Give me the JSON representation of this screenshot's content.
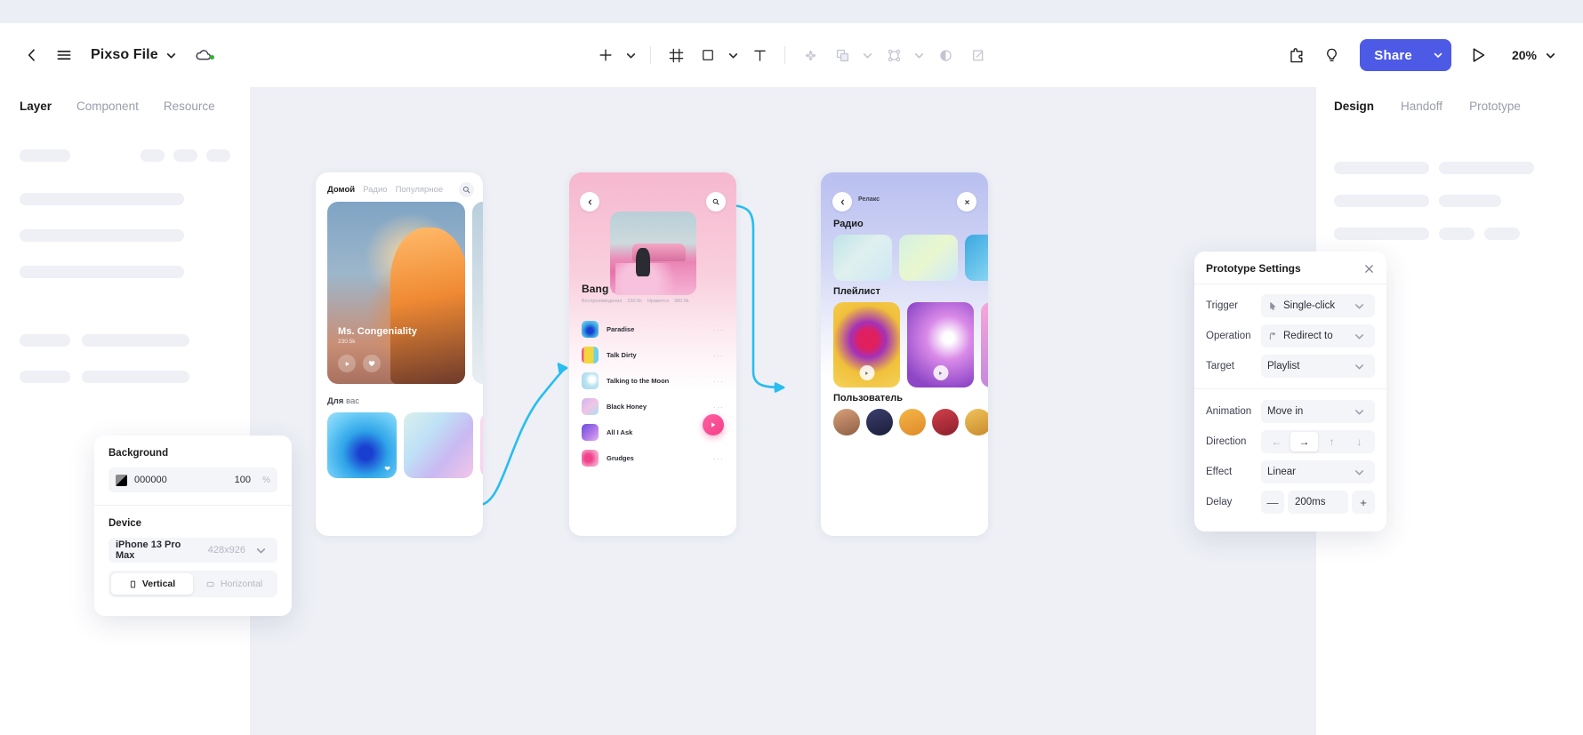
{
  "app": {
    "file_title": "Pixso File",
    "zoom_level": "20%",
    "share_label": "Share"
  },
  "topbar": {
    "back_icon": "chevron-left-icon",
    "menu_icon": "hamburger-menu-icon",
    "title_chevron_icon": "chevron-down-icon",
    "cloud_icon": "cloud-saved-icon",
    "tools": [
      {
        "name": "add-icon",
        "label": "Add",
        "dim": false,
        "chevron": true
      },
      {
        "name": "frame-icon",
        "label": "Frame",
        "dim": false,
        "chevron": false
      },
      {
        "name": "shape-rectangle-icon",
        "label": "Shape",
        "dim": false,
        "chevron": true
      },
      {
        "name": "text-icon",
        "label": "Text",
        "dim": false,
        "chevron": false
      },
      {
        "name": "vector-move-icon",
        "label": "Vector",
        "dim": true,
        "chevron": false
      },
      {
        "name": "boolean-union-icon",
        "label": "Boolean",
        "dim": true,
        "chevron": true
      },
      {
        "name": "component-icon",
        "label": "Component",
        "dim": true,
        "chevron": true
      },
      {
        "name": "mask-icon",
        "label": "Mask",
        "dim": true,
        "chevron": false
      },
      {
        "name": "slice-icon",
        "label": "Slice",
        "dim": true,
        "chevron": false
      }
    ],
    "plugin_icon": "plugin-puzzle-icon",
    "idea_icon": "lightbulb-icon",
    "present_icon": "play-present-icon"
  },
  "left_panel": {
    "tabs": [
      {
        "label": "Layer",
        "active": true
      },
      {
        "label": "Component",
        "active": false
      },
      {
        "label": "Resource",
        "active": false
      }
    ]
  },
  "right_panel": {
    "tabs": [
      {
        "label": "Design",
        "active": true
      },
      {
        "label": "Handoff",
        "active": false
      },
      {
        "label": "Prototype",
        "active": false
      }
    ]
  },
  "background_panel": {
    "background_label": "Background",
    "color_hex": "000000",
    "opacity": "100",
    "opacity_unit": "%",
    "device_label": "Device",
    "device_name": "iPhone 13 Pro Max",
    "device_size": "428x926",
    "orientation": [
      {
        "label": "Vertical",
        "active": true,
        "icon": "portrait-icon"
      },
      {
        "label": "Horizontal",
        "active": false,
        "icon": "landscape-icon"
      }
    ]
  },
  "prototype_panel": {
    "title": "Prototype Settings",
    "close_icon": "close-icon",
    "rows": [
      {
        "label": "Trigger",
        "value": "Single-click",
        "icon": "cursor-click-icon"
      },
      {
        "label": "Operation",
        "value": "Redirect to",
        "icon": "redirect-arrow-icon"
      },
      {
        "label": "Target",
        "value": "Playlist",
        "icon": ""
      }
    ],
    "rows2": [
      {
        "label": "Animation",
        "value": "Move in",
        "icon": ""
      },
      {
        "label": "Effect",
        "value": "Linear",
        "icon": ""
      }
    ],
    "direction_label": "Direction",
    "directions": [
      {
        "name": "arrow-left-icon",
        "glyph": "←",
        "active": false
      },
      {
        "name": "arrow-right-icon",
        "glyph": "→",
        "active": true
      },
      {
        "name": "arrow-up-icon",
        "glyph": "↑",
        "active": false
      },
      {
        "name": "arrow-down-icon",
        "glyph": "↓",
        "active": false
      }
    ],
    "delay_label": "Delay",
    "delay_value": "200ms",
    "minus_glyph": "—",
    "plus_glyph": "+"
  },
  "mockups": {
    "screen1": {
      "nav": [
        {
          "label": "Домой",
          "active": true
        },
        {
          "label": "Радио",
          "active": false
        },
        {
          "label": "Популярное",
          "active": false
        }
      ],
      "search_icon": "search-icon",
      "hero_title": "Ms. Congeniality",
      "hero_plays": "230.5k",
      "play_icon": "play-icon",
      "like_icon": "heart-icon",
      "section_bold": "Для",
      "section_light": "вас"
    },
    "screen2": {
      "back_icon": "chevron-left-icon",
      "search_icon": "search-icon",
      "song_title": "Bang Bang",
      "meta_plays_label": "Воспроизведения",
      "meta_plays_value": "230.5k",
      "meta_likes_label": "Нравится",
      "meta_likes_value": "980.5k",
      "play_icon": "play-icon",
      "tracks": [
        {
          "name": "Paradise",
          "color": "#3aa8e0"
        },
        {
          "name": "Talk Dirty",
          "color": "#f2d73c"
        },
        {
          "name": "Talking to the Moon",
          "color": "#cfe8f2"
        },
        {
          "name": "Black Honey",
          "color": "#cdb7f0"
        },
        {
          "name": "All I Ask",
          "color": "#8e6fe0"
        },
        {
          "name": "Grudges",
          "color": "#f07ab0"
        }
      ],
      "more_glyph": "···"
    },
    "screen3": {
      "back_icon": "chevron-left-icon",
      "header_label": "Релакс",
      "close_icon": "close-icon",
      "section_radio": "Радио",
      "section_playlist": "Плейлист",
      "section_user": "Пользователь",
      "play_icon": "play-icon"
    }
  },
  "colors": {
    "accent": "#4d5ae5",
    "canvas": "#eef0f6",
    "connector": "#29bdf0",
    "panel_field": "#f4f5f9"
  }
}
